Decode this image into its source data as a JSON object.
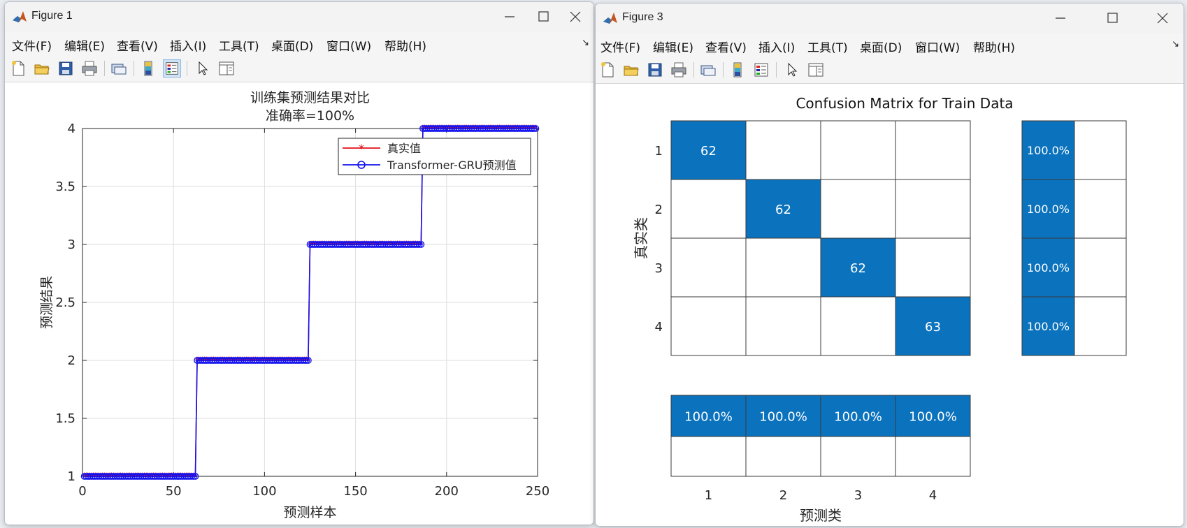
{
  "window1": {
    "title": "Figure 1",
    "menu": [
      "文件(F)",
      "编辑(E)",
      "查看(V)",
      "插入(I)",
      "工具(T)",
      "桌面(D)",
      "窗口(W)",
      "帮助(H)"
    ],
    "plot": {
      "title_line1": "训练集预测结果对比",
      "title_line2": "准确率=100%",
      "xlabel": "预测样本",
      "ylabel": "预测结果",
      "x_ticks": [
        "0",
        "50",
        "100",
        "150",
        "200",
        "250"
      ],
      "y_ticks": [
        "1",
        "1.5",
        "2",
        "2.5",
        "3",
        "3.5",
        "4"
      ],
      "legend": [
        "真实值",
        "Transformer-GRU预测值"
      ]
    }
  },
  "window2": {
    "title": "Figure 3",
    "menu": [
      "文件(F)",
      "编辑(E)",
      "查看(V)",
      "插入(I)",
      "工具(T)",
      "桌面(D)",
      "窗口(W)",
      "帮助(H)"
    ],
    "confusion": {
      "title": "Confusion Matrix for Train Data",
      "xlabel": "预测类",
      "ylabel": "真实类",
      "class_labels": [
        "1",
        "2",
        "3",
        "4"
      ],
      "matrix": [
        [
          62,
          0,
          0,
          0
        ],
        [
          0,
          62,
          0,
          0
        ],
        [
          0,
          0,
          62,
          0
        ],
        [
          0,
          0,
          0,
          63
        ]
      ],
      "row_summary": [
        "100.0%",
        "100.0%",
        "100.0%",
        "100.0%"
      ],
      "col_summary": [
        "100.0%",
        "100.0%",
        "100.0%",
        "100.0%"
      ]
    }
  },
  "colors": {
    "cell_blue": "#0b72bd",
    "true_series": "#e3101a",
    "pred_series": "#1212ee"
  },
  "chart_data": [
    {
      "type": "line",
      "title": "训练集预测结果对比 准确率=100%",
      "xlabel": "预测样本",
      "ylabel": "预测结果",
      "xlim": [
        0,
        250
      ],
      "ylim": [
        1,
        4
      ],
      "grid": true,
      "legend_position": "top-right",
      "series": [
        {
          "name": "真实值",
          "steps": [
            {
              "x_from": 1,
              "x_to": 62,
              "y": 1
            },
            {
              "x_from": 63,
              "x_to": 124,
              "y": 2
            },
            {
              "x_from": 125,
              "x_to": 186,
              "y": 3
            },
            {
              "x_from": 187,
              "x_to": 249,
              "y": 4
            }
          ]
        },
        {
          "name": "Transformer-GRU预测值",
          "steps": [
            {
              "x_from": 1,
              "x_to": 62,
              "y": 1
            },
            {
              "x_from": 63,
              "x_to": 124,
              "y": 2
            },
            {
              "x_from": 125,
              "x_to": 186,
              "y": 3
            },
            {
              "x_from": 187,
              "x_to": 249,
              "y": 4
            }
          ]
        }
      ]
    },
    {
      "type": "heatmap",
      "title": "Confusion Matrix for Train Data",
      "xlabel": "预测类",
      "ylabel": "真实类",
      "categories": [
        "1",
        "2",
        "3",
        "4"
      ],
      "values": [
        [
          62,
          0,
          0,
          0
        ],
        [
          0,
          62,
          0,
          0
        ],
        [
          0,
          0,
          62,
          0
        ],
        [
          0,
          0,
          0,
          63
        ]
      ],
      "row_summary": [
        "100.0%",
        "100.0%",
        "100.0%",
        "100.0%"
      ],
      "col_summary": [
        "100.0%",
        "100.0%",
        "100.0%",
        "100.0%"
      ]
    }
  ]
}
